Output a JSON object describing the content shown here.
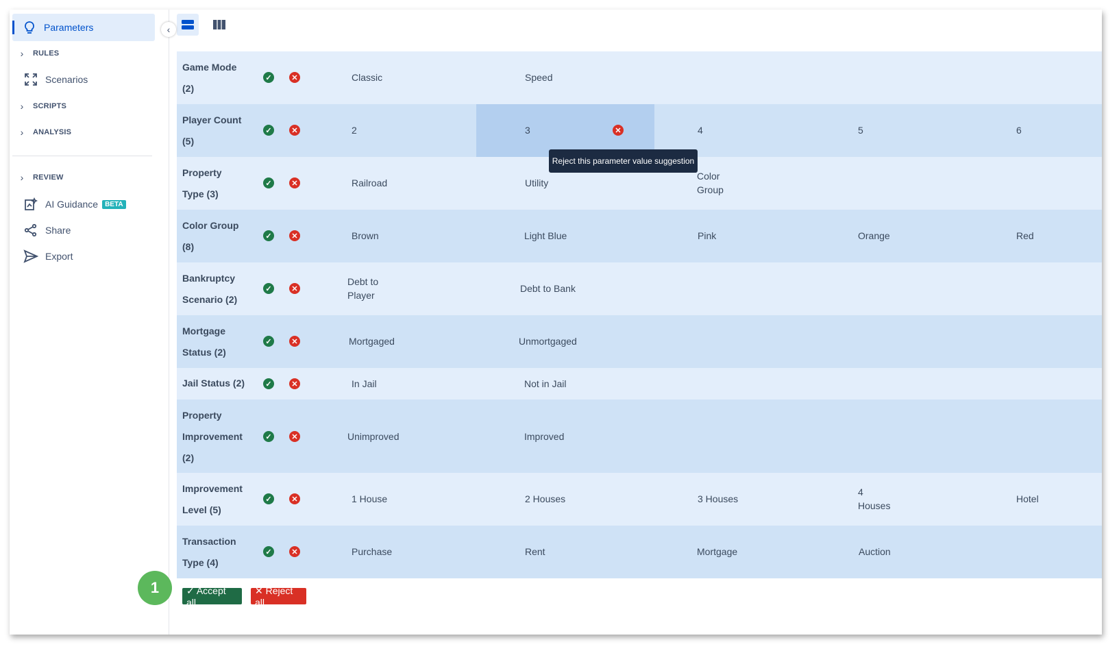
{
  "sidebar": {
    "items": [
      {
        "label": "Parameters",
        "icon": "lightbulb-icon"
      },
      {
        "label": "RULES",
        "icon": "chevron-right-icon"
      },
      {
        "label": "Scenarios",
        "icon": "expand-icon"
      },
      {
        "label": "SCRIPTS",
        "icon": "chevron-right-icon"
      },
      {
        "label": "ANALYSIS",
        "icon": "chevron-right-icon"
      },
      {
        "label": "REVIEW",
        "icon": "chevron-right-icon"
      },
      {
        "label": "AI Guidance",
        "icon": "ai-guidance-icon",
        "badge": "BETA"
      },
      {
        "label": "Share",
        "icon": "share-icon"
      },
      {
        "label": "Export",
        "icon": "send-icon"
      }
    ],
    "collapse_icon": "chevron-left-icon"
  },
  "toolbar": {
    "row_view_icon": "rows-view-icon",
    "column_view_icon": "columns-view-icon"
  },
  "table": {
    "rows": [
      {
        "name1": "Game Mode",
        "name2": "(2)",
        "values": [
          "Classic",
          "Speed"
        ]
      },
      {
        "name1": "Player Count",
        "name2": "(5)",
        "values": [
          "2",
          "3",
          "4",
          "5",
          "6"
        ]
      },
      {
        "name1": "Property",
        "name2": "Type (3)",
        "values": [
          "Railroad",
          "Utility",
          "Color Group"
        ],
        "v3_lines": [
          "Color",
          "Group"
        ]
      },
      {
        "name1": "Color Group",
        "name2": "(8)",
        "values": [
          "Brown",
          "Light Blue",
          "Pink",
          "Orange",
          "Red"
        ]
      },
      {
        "name1": "Bankruptcy",
        "name2": "Scenario (2)",
        "values": [
          "Debt to Player",
          "Debt to Bank"
        ],
        "v1_lines": [
          "Debt to",
          "Player"
        ]
      },
      {
        "name1": "Mortgage",
        "name2": "Status (2)",
        "values": [
          "Mortgaged",
          "Unmortgaged"
        ]
      },
      {
        "name1": "Jail Status (2)",
        "values": [
          "In Jail",
          "Not in Jail"
        ]
      },
      {
        "name1": "Property",
        "name2": "Improvement",
        "name3": "(2)",
        "values": [
          "Unimproved",
          "Improved"
        ]
      },
      {
        "name1": "Improvement",
        "name2": "Level (5)",
        "values": [
          "1 House",
          "2 Houses",
          "3 Houses",
          "4 Houses",
          "Hotel"
        ],
        "v4_lines": [
          "4",
          "Houses"
        ]
      },
      {
        "name1": "Transaction",
        "name2": "Type (4)",
        "values": [
          "Purchase",
          "Rent",
          "Mortgage",
          "Auction"
        ]
      }
    ]
  },
  "tooltip": "Reject this parameter value suggestion",
  "footer": {
    "step_badge": "1",
    "accept_label": "✓ Accept all",
    "reject_label": "✕ Reject all"
  },
  "colors": {
    "accent": "#0052cc",
    "accept": "#1f7a48",
    "reject": "#d93025",
    "row_light": "#e3eefb",
    "row_dark": "#cfe2f6"
  }
}
